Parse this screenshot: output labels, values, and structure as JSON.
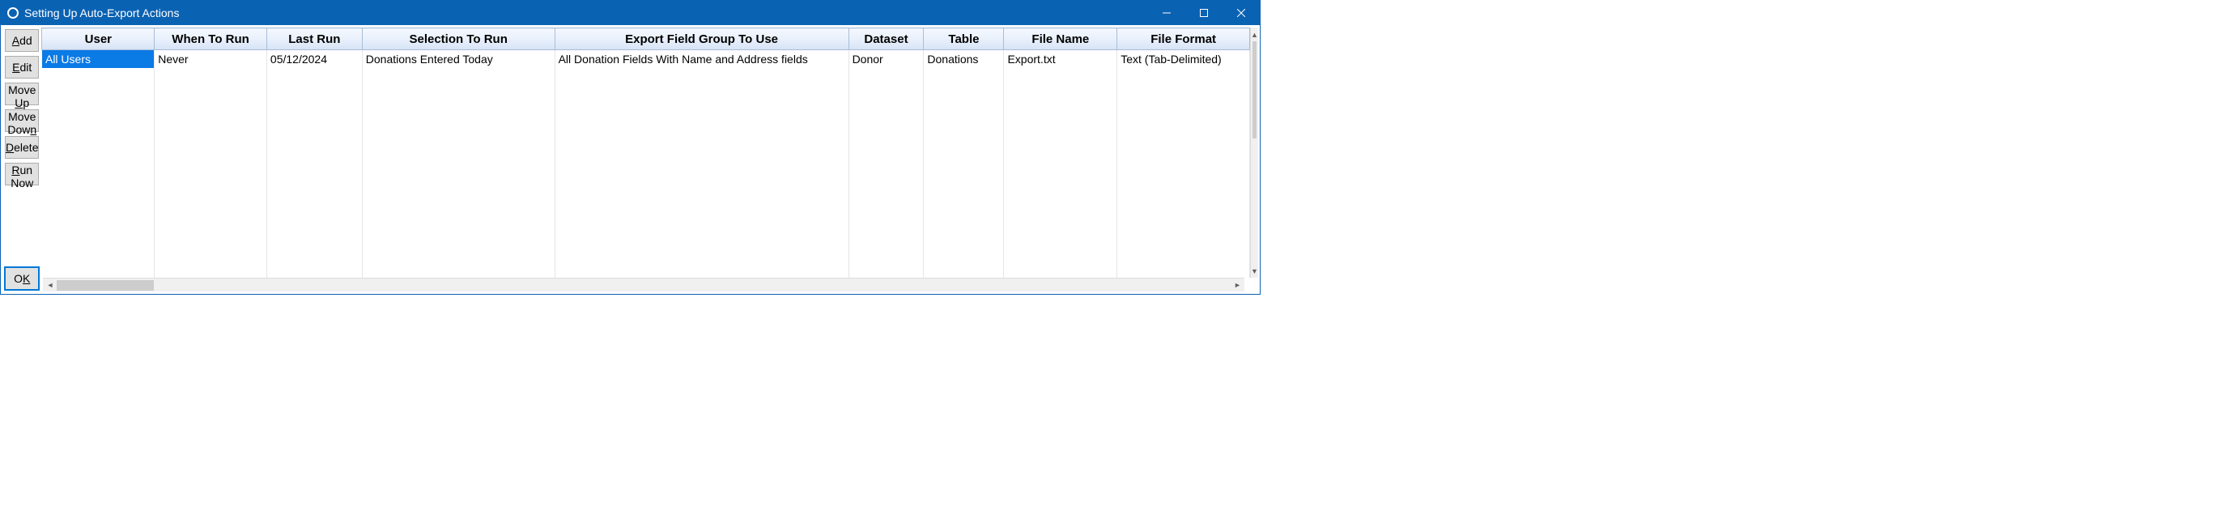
{
  "window": {
    "title": "Setting Up Auto-Export Actions"
  },
  "sidebar": {
    "add": {
      "pre": "",
      "accel": "A",
      "post": "dd"
    },
    "edit": {
      "pre": "",
      "accel": "E",
      "post": "dit"
    },
    "move_up": {
      "pre": "Move ",
      "accel": "U",
      "post": "p"
    },
    "move_down": {
      "pre": "Move Dow",
      "accel": "n",
      "post": ""
    },
    "delete": {
      "pre": "",
      "accel": "D",
      "post": "elete"
    },
    "run_now": {
      "pre": "",
      "accel": "R",
      "post": "un Now"
    },
    "ok": {
      "pre": "O",
      "accel": "K",
      "post": ""
    }
  },
  "columns": {
    "user": "User",
    "when": "When To Run",
    "last": "Last Run",
    "selection": "Selection To Run",
    "fieldgroup": "Export Field Group To Use",
    "dataset": "Dataset",
    "table": "Table",
    "filename": "File Name",
    "format": "File Format"
  },
  "rows": [
    {
      "user": "All Users",
      "when": "Never",
      "last": "05/12/2024",
      "selection": "Donations Entered Today",
      "fieldgroup": "All Donation Fields With Name and Address fields",
      "dataset": "Donor",
      "table": "Donations",
      "filename": "Export.txt",
      "format": "Text (Tab-Delimited)"
    }
  ]
}
